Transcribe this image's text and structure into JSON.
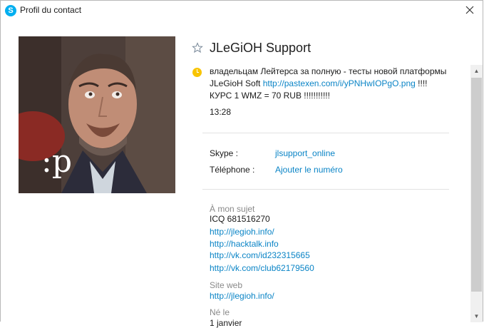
{
  "window": {
    "title": "Profil du contact",
    "close_icon": "close-icon"
  },
  "contact": {
    "name": "JLeGiOH Support",
    "avatar_caption": ":p",
    "status": "away",
    "mood_text_1": "владельцам Лейтерса за полную - тесты новой платформы JLeGioH Soft ",
    "mood_link": "http://pastexen.com/i/yPNHwIOPgO.png",
    "mood_text_2": " !!!! КУРС 1 WMZ = 70 RUB !!!!!!!!!!!",
    "mood_time": "13:28"
  },
  "fields": {
    "skype_label": "Skype :",
    "skype_value": "jlsupport_online",
    "phone_label": "Téléphone :",
    "phone_value": "Ajouter le numéro"
  },
  "about": {
    "label": "À mon sujet",
    "icq": "ICQ 681516270",
    "links": [
      "http://jlegioh.info/",
      "http://hacktalk.info",
      "http://vk.com/id232315665",
      "http://vk.com/club62179560"
    ]
  },
  "website": {
    "label": "Site web",
    "link": "http://jlegioh.info/"
  },
  "birth": {
    "label": "Né le",
    "value": "1 janvier"
  },
  "colors": {
    "accent": "#0a84c6",
    "away": "#f8c400",
    "skype": "#00aff0"
  }
}
